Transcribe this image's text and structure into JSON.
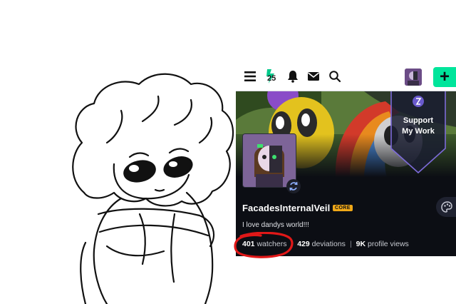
{
  "topbar": {
    "menu_icon": "hamburger-menu-icon",
    "badge_text": "25",
    "bell_icon": "bell-icon",
    "mail_icon": "mail-icon",
    "search_icon": "search-icon",
    "plus_label": "+"
  },
  "banner": {
    "support_line1": "Support",
    "support_line2": "My Work"
  },
  "profile": {
    "username": "FacadesInternalVeil",
    "core_badge": "CORE",
    "bio": "I love dandys world!!!"
  },
  "stats": {
    "watchers_value": "401",
    "watchers_label": "watchers",
    "deviations_value": "429",
    "deviations_label": "deviations",
    "views_value": "9K",
    "views_label": "profile views",
    "separator": "|"
  },
  "colors": {
    "accent_green": "#00e59b",
    "core_orange": "#f0a818",
    "annotation_red": "#e01818",
    "dark_bg": "#0c0e14"
  }
}
